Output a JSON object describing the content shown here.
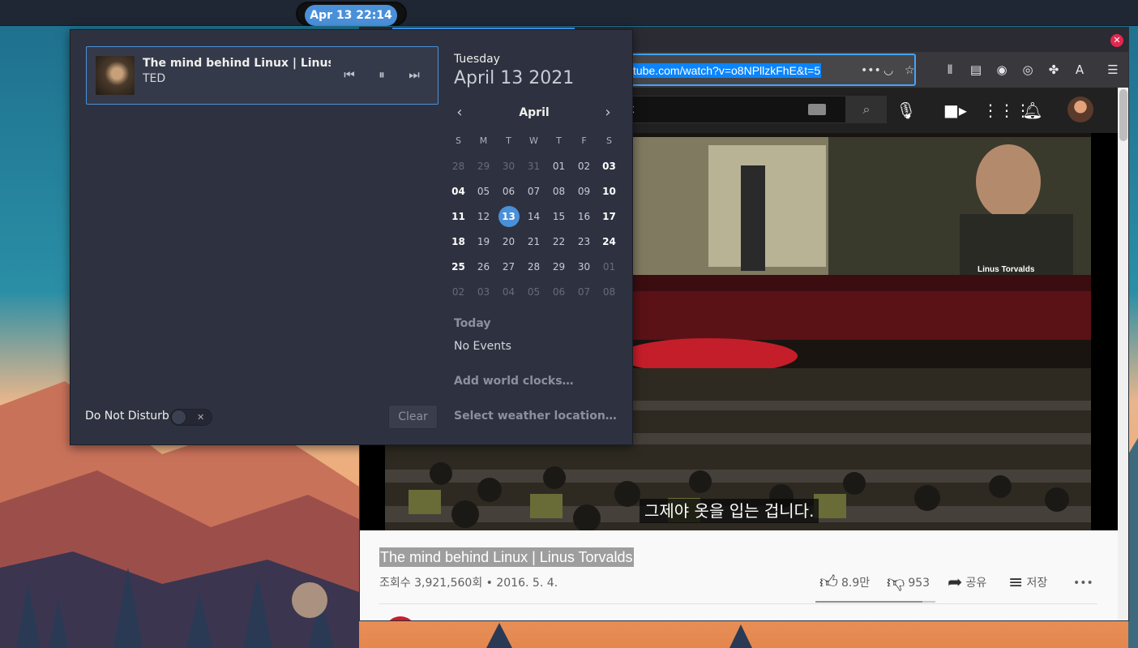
{
  "topbar": {
    "clock": "Apr 13  22:14"
  },
  "popover": {
    "media": {
      "title": "The mind behind Linux | Linus T…",
      "artist": "TED"
    },
    "dnd": {
      "label": "Do Not Disturb",
      "enabled": false
    },
    "clear_label": "Clear",
    "calendar": {
      "weekday": "Tuesday",
      "date": "April 13 2021",
      "month": "April",
      "day_headers": [
        "S",
        "M",
        "T",
        "W",
        "T",
        "F",
        "S"
      ],
      "weeks": [
        [
          "28",
          "29",
          "30",
          "31",
          "01",
          "02",
          "03"
        ],
        [
          "04",
          "05",
          "06",
          "07",
          "08",
          "09",
          "10"
        ],
        [
          "11",
          "12",
          "13",
          "14",
          "15",
          "16",
          "17"
        ],
        [
          "18",
          "19",
          "20",
          "21",
          "22",
          "23",
          "24"
        ],
        [
          "25",
          "26",
          "27",
          "28",
          "29",
          "30",
          "01"
        ],
        [
          "02",
          "03",
          "04",
          "05",
          "06",
          "07",
          "08"
        ]
      ],
      "today": "13"
    },
    "events": {
      "heading": "Today",
      "empty": "No Events"
    },
    "world_clocks": "Add world clocks…",
    "weather": "Select weather location…"
  },
  "browser": {
    "url": "tube.com/watch?v=o8NPllzkFhE&t=5",
    "search_text": "x",
    "video": {
      "subtitle": "그제야 옷을 입는 겁니다.",
      "overlay_name": "Linus Torvalds"
    },
    "title": "The mind behind Linux | Linus Torvalds",
    "meta": "조회수 3,921,560회 • 2016. 5. 4.",
    "likes": "8.9만",
    "dislikes": "953",
    "like_ratio": 0.89,
    "share": "공유",
    "save": "저장"
  },
  "colors": {
    "accent": "#4a90d9",
    "panel": "#2e3240",
    "url_highlight": "#0a84ff",
    "yt_dark": "#212121"
  }
}
